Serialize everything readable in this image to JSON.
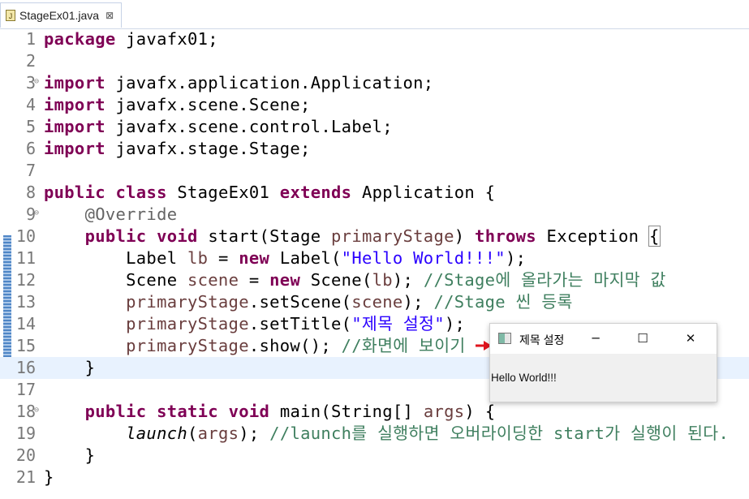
{
  "tab": {
    "filename": "StageEx01.java",
    "close": "⊠"
  },
  "colors": {
    "keyword": "#7f0055",
    "string": "#2a00ff",
    "comment": "#3f7f5f",
    "annotation": "#646464",
    "variable": "#6a3e3e",
    "current_line": "#e8f2fe"
  },
  "lines": [
    {
      "n": "1"
    },
    {
      "n": "2"
    },
    {
      "n": "3"
    },
    {
      "n": "4"
    },
    {
      "n": "5"
    },
    {
      "n": "6"
    },
    {
      "n": "7"
    },
    {
      "n": "8"
    },
    {
      "n": "9"
    },
    {
      "n": "10"
    },
    {
      "n": "11"
    },
    {
      "n": "12"
    },
    {
      "n": "13"
    },
    {
      "n": "14"
    },
    {
      "n": "15"
    },
    {
      "n": "16"
    },
    {
      "n": "17"
    },
    {
      "n": "18"
    },
    {
      "n": "19"
    },
    {
      "n": "20"
    },
    {
      "n": "21"
    }
  ],
  "code": {
    "l1": {
      "kw": "package",
      "rest": " javafx01;"
    },
    "l3": {
      "kw": "import",
      "rest": " javafx.application.Application;"
    },
    "l4": {
      "kw": "import",
      "rest": " javafx.scene.Scene;"
    },
    "l5": {
      "kw": "import",
      "rest": " javafx.scene.control.Label;"
    },
    "l6": {
      "kw": "import",
      "rest": " javafx.stage.Stage;"
    },
    "l8": {
      "kw1": "public",
      "kw2": "class",
      "name": " StageEx01 ",
      "kw3": "extends",
      "rest": " Application {"
    },
    "l9": {
      "ann": "@Override"
    },
    "l10": {
      "kw1": "public",
      "kw2": "void",
      "a": " start(Stage ",
      "var": "primaryStage",
      "b": ") ",
      "kw3": "throws",
      "c": " Exception ",
      "brace": "{"
    },
    "l11": {
      "a": "Label ",
      "var": "lb",
      "b": " = ",
      "kw": "new",
      "c": " Label(",
      "str": "\"Hello World!!!\"",
      "d": ");"
    },
    "l12": {
      "a": "Scene ",
      "var": "scene",
      "b": " = ",
      "kw": "new",
      "c": " Scene(",
      "var2": "lb",
      "d": "); ",
      "cmt": "//Stage에 올라가는 마지막 값"
    },
    "l13": {
      "var": "primaryStage",
      "a": ".setScene(",
      "var2": "scene",
      "b": "); ",
      "cmt": "//Stage 씬 등록"
    },
    "l14": {
      "var": "primaryStage",
      "a": ".setTitle(",
      "str": "\"제목 설정\"",
      "b": ");"
    },
    "l15": {
      "var": "primaryStage",
      "a": ".show(); ",
      "cmt": "//화면에 보이기"
    },
    "l16": {
      "a": "}"
    },
    "l18": {
      "kw1": "public",
      "kw2": "static",
      "kw3": "void",
      "a": " main(String[] ",
      "var": "args",
      "b": ") {"
    },
    "l19": {
      "st": "launch",
      "a": "(",
      "var": "args",
      "b": "); ",
      "cmt": "//launch를 실행하면 오버라이딩한 start가 실행이 된다."
    },
    "l20": {
      "a": "}"
    },
    "l21": {
      "a": "}"
    }
  },
  "fx_window": {
    "title": "제목 설정",
    "minimize": "─",
    "maximize": "☐",
    "close": "✕",
    "label": "Hello World!!!"
  }
}
